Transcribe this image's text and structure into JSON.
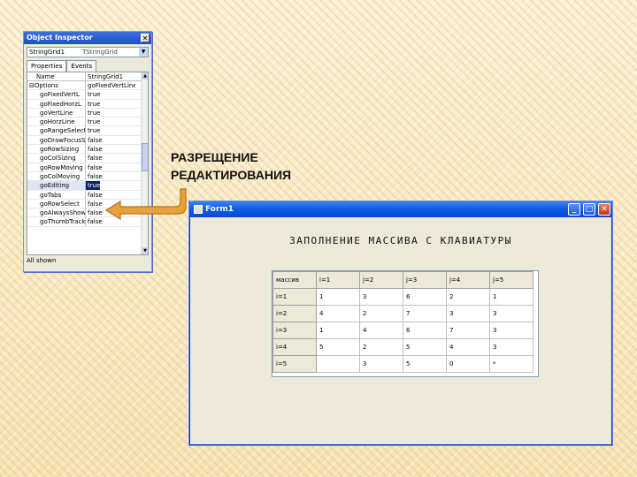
{
  "object_inspector": {
    "title": "Object Inspector",
    "close_glyph": "✕",
    "selected_component": "StringGrid1",
    "selected_type": "TStringGrid",
    "tabs": [
      "Properties",
      "Events"
    ],
    "header_name": "Name",
    "header_value": "StringGrid1",
    "rows": [
      {
        "name": "Options",
        "value": "goFixedVertLine",
        "group": true
      },
      {
        "name": "goFixedVertL",
        "value": "true"
      },
      {
        "name": "goFixedHorzL",
        "value": "true"
      },
      {
        "name": "goVertLine",
        "value": "true"
      },
      {
        "name": "goHorzLine",
        "value": "true"
      },
      {
        "name": "goRangeSelect",
        "value": "true"
      },
      {
        "name": "goDrawFocusS",
        "value": "false"
      },
      {
        "name": "goRowSizing",
        "value": "false"
      },
      {
        "name": "goColSizing",
        "value": "false"
      },
      {
        "name": "goRowMoving",
        "value": "false"
      },
      {
        "name": "goColMoving",
        "value": "false"
      },
      {
        "name": "goEditing",
        "value": "true",
        "selected": true
      },
      {
        "name": "goTabs",
        "value": "false"
      },
      {
        "name": "goRowSelect",
        "value": "false"
      },
      {
        "name": "goAlwaysShow",
        "value": "false"
      },
      {
        "name": "goThumbTrack",
        "value": "false"
      }
    ],
    "group_marker": "⊟",
    "status": "All shown"
  },
  "caption": {
    "line1": "РАЗРЕЩЕНИЕ",
    "line2": "РЕДАКТИРОВАНИЯ"
  },
  "arrow": {
    "color": "#e9a13b",
    "border": "#b5711a"
  },
  "form": {
    "title": "Form1",
    "btn_min": "_",
    "btn_max": "□",
    "btn_close": "✕",
    "heading": "ЗАПОЛНЕНИЕ МАССИВА С КЛАВИАТУРЫ",
    "grid": {
      "header": [
        "массив",
        "i=1",
        "j=2",
        "j=3",
        "j=4",
        "j=5"
      ],
      "rows": [
        [
          "i=1",
          "1",
          "3",
          "6",
          "2",
          "1"
        ],
        [
          "i=2",
          "4",
          "2",
          "7",
          "3",
          "3"
        ],
        [
          "i=3",
          "1",
          "4",
          "6",
          "7",
          "3"
        ],
        [
          "i=4",
          "5",
          "2",
          "5",
          "4",
          "3"
        ],
        [
          "i=5",
          "",
          "3",
          "5",
          "0",
          "*"
        ]
      ]
    }
  }
}
